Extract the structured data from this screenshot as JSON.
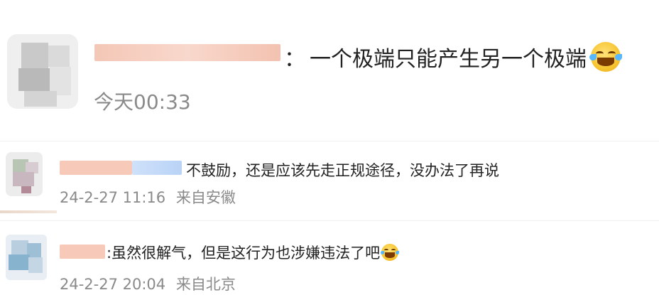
{
  "main_comment": {
    "separator": "：",
    "text": "一个极端只能产生另一个极端",
    "emoji": "laugh-cry-emoji",
    "time": "今天00:33"
  },
  "replies": [
    {
      "text": "不鼓励，还是应该先走正规途径，没办法了再说",
      "time": "24-2-27 11:16",
      "location": "来自安徽"
    },
    {
      "text": ":虽然很解气，但是这行为也涉嫌违法了吧",
      "emoji": "laugh-cry-emoji",
      "time": "24-2-27 20:04",
      "location": "来自北京"
    }
  ],
  "colors": {
    "name_blur": "#f6c9b8",
    "time_text": "#8a8a8a",
    "body_text": "#222222"
  }
}
